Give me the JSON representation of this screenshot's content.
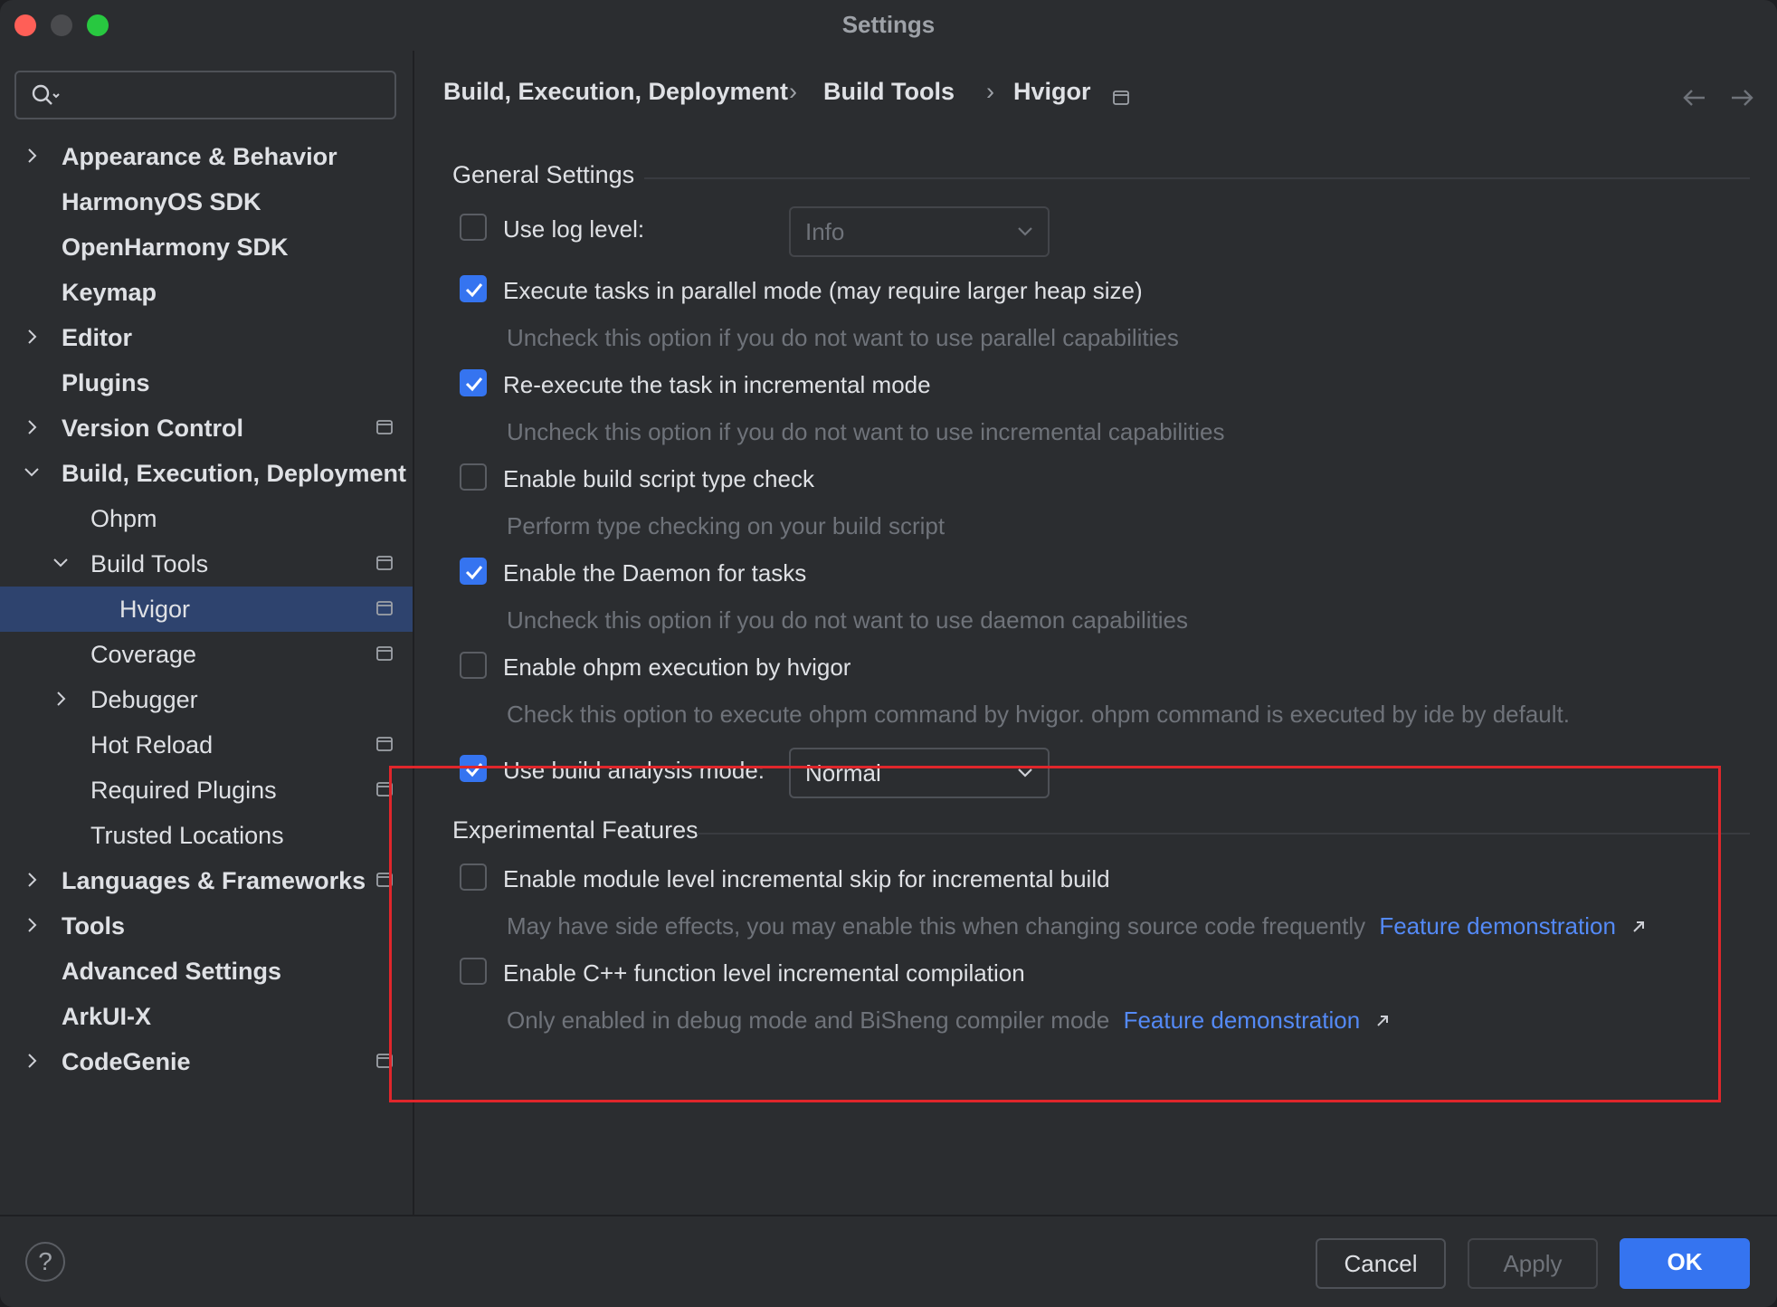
{
  "window": {
    "title": "Settings",
    "traffic_light_colors": [
      "#ff5f57",
      "#4a4b4e",
      "#28c840"
    ]
  },
  "search": {
    "icon": "search-icon",
    "placeholder": ""
  },
  "sidebar": {
    "items": [
      {
        "label": "Appearance & Behavior",
        "level": 0,
        "chevron": "right",
        "bold": true,
        "project_icon": false
      },
      {
        "label": "HarmonyOS SDK",
        "level": 0,
        "chevron": null,
        "bold": true,
        "project_icon": false
      },
      {
        "label": "OpenHarmony SDK",
        "level": 0,
        "chevron": null,
        "bold": true,
        "project_icon": false
      },
      {
        "label": "Keymap",
        "level": 0,
        "chevron": null,
        "bold": true,
        "project_icon": false
      },
      {
        "label": "Editor",
        "level": 0,
        "chevron": "right",
        "bold": true,
        "project_icon": false
      },
      {
        "label": "Plugins",
        "level": 0,
        "chevron": null,
        "bold": true,
        "project_icon": false
      },
      {
        "label": "Version Control",
        "level": 0,
        "chevron": "right",
        "bold": true,
        "project_icon": true
      },
      {
        "label": "Build, Execution, Deployment",
        "level": 0,
        "chevron": "down",
        "bold": true,
        "project_icon": false
      },
      {
        "label": "Ohpm",
        "level": 1,
        "chevron": null,
        "bold": false,
        "project_icon": false
      },
      {
        "label": "Build Tools",
        "level": 1,
        "chevron": "down",
        "bold": false,
        "project_icon": true
      },
      {
        "label": "Hvigor",
        "level": 2,
        "chevron": null,
        "bold": false,
        "project_icon": true,
        "selected": true
      },
      {
        "label": "Coverage",
        "level": 1,
        "chevron": null,
        "bold": false,
        "project_icon": true
      },
      {
        "label": "Debugger",
        "level": 1,
        "chevron": "right",
        "bold": false,
        "project_icon": false
      },
      {
        "label": "Hot Reload",
        "level": 1,
        "chevron": null,
        "bold": false,
        "project_icon": true
      },
      {
        "label": "Required Plugins",
        "level": 1,
        "chevron": null,
        "bold": false,
        "project_icon": true
      },
      {
        "label": "Trusted Locations",
        "level": 1,
        "chevron": null,
        "bold": false,
        "project_icon": false
      },
      {
        "label": "Languages & Frameworks",
        "level": 0,
        "chevron": "right",
        "bold": true,
        "project_icon": true
      },
      {
        "label": "Tools",
        "level": 0,
        "chevron": "right",
        "bold": true,
        "project_icon": false
      },
      {
        "label": "Advanced Settings",
        "level": 0,
        "chevron": null,
        "bold": true,
        "project_icon": false
      },
      {
        "label": "ArkUI-X",
        "level": 0,
        "chevron": null,
        "bold": true,
        "project_icon": false
      },
      {
        "label": "CodeGenie",
        "level": 0,
        "chevron": "right",
        "bold": true,
        "project_icon": true
      }
    ]
  },
  "breadcrumb": {
    "parts": [
      "Build, Execution, Deployment",
      "Build Tools",
      "Hvigor"
    ],
    "separator": "›",
    "back_icon": "arrow-left-icon",
    "forward_icon": "arrow-right-icon"
  },
  "general": {
    "title": "General Settings",
    "log_level": {
      "label": "Use log level:",
      "checked": false,
      "value": "Info"
    },
    "parallel": {
      "label": "Execute tasks in parallel mode (may require larger heap size)",
      "checked": true,
      "hint": "Uncheck this option if you do not want to use parallel capabilities"
    },
    "incremental": {
      "label": "Re-execute the task in incremental mode",
      "checked": true,
      "hint": "Uncheck this option if you do not want to use incremental capabilities"
    },
    "type_check": {
      "label": "Enable build script type check",
      "checked": false,
      "hint": "Perform type checking on your build script"
    },
    "daemon": {
      "label": "Enable the Daemon for tasks",
      "checked": true,
      "hint": "Uncheck this option if you do not want to use daemon capabilities"
    },
    "ohpm": {
      "label": "Enable ohpm execution by hvigor",
      "checked": false,
      "hint": "Check this option to execute ohpm command by hvigor. ohpm command is executed by ide by default."
    },
    "analysis": {
      "label": "Use build analysis mode:",
      "checked": true,
      "value": "Normal"
    }
  },
  "experimental": {
    "title": "Experimental Features",
    "module_skip": {
      "label": "Enable module level incremental skip for incremental build",
      "checked": false,
      "hint": "May have side effects, you may enable this when changing source code frequently",
      "link": "Feature demonstration"
    },
    "cpp_incremental": {
      "label": "Enable C++ function level incremental compilation",
      "checked": false,
      "hint": "Only enabled in debug mode and BiSheng compiler mode",
      "link": "Feature demonstration"
    }
  },
  "footer": {
    "help": "?",
    "cancel": "Cancel",
    "apply": "Apply",
    "ok": "OK"
  },
  "colors": {
    "accent": "#3574f0",
    "link": "#548af7",
    "selection": "#2e436e",
    "highlight_box": "#e0262b"
  }
}
